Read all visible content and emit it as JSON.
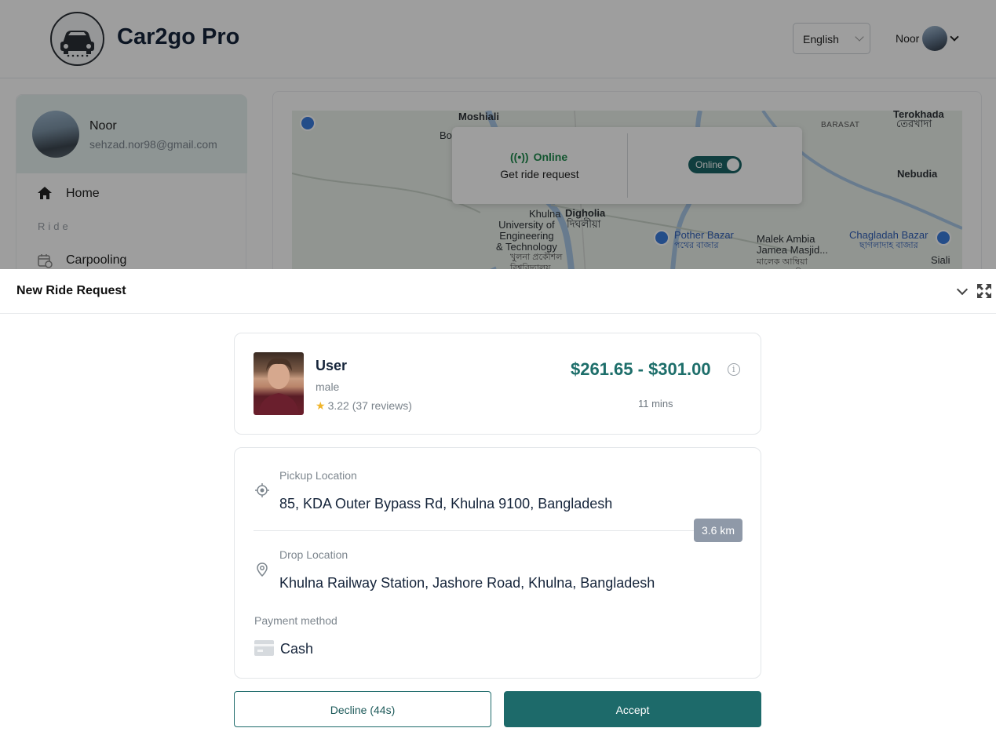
{
  "header": {
    "brand": "Car2go Pro",
    "language": "English",
    "user_name": "Noor"
  },
  "sidebar": {
    "profile_name": "Noor",
    "profile_email": "sehzad.nor98@gmail.com",
    "home_label": "Home",
    "section_label": "Ride",
    "carpooling_label": "Carpooling"
  },
  "map": {
    "labels": {
      "moshiali": "Moshiali",
      "bo": "Bo",
      "terokhada": "Terokhada",
      "terokhada_bn": "তেরখাদা",
      "barasat": "BARASAT",
      "nebudia": "Nebudia",
      "khulna": "Khulna",
      "digholia": "Digholia",
      "digholia_bn": "দিঘলীয়া",
      "university": "University of\nEngineering\n& Technology",
      "university_bn": "খুলনা প্রকৌশল\nবিশ্ববিদ্যালয়",
      "pother_bazar": "Pother Bazar",
      "pother_bazar_bn": "পথের বাজার",
      "malek_ambia": "Malek Ambia\nJamea Masjid...",
      "malek_ambia_bn": "মালেক আম্বিয়া\nজামেয়া মসজিদ",
      "chagladah": "Chagladah Bazar",
      "chagladah_bn": "ছাগলাদাহ বাজার",
      "siali": "Siali"
    }
  },
  "status_panel": {
    "status": "Online",
    "subtitle": "Get ride request",
    "toggle_label": "Online"
  },
  "sheet": {
    "title": "New Ride Request",
    "rider": {
      "name": "User",
      "gender": "male",
      "rating": "3.22 (37 reviews)"
    },
    "fare": "$261.65 - $301.00",
    "eta": "11 mins",
    "pickup_label": "Pickup Location",
    "pickup_value": "85, KDA Outer Bypass Rd, Khulna 9100, Bangladesh",
    "distance": "3.6 km",
    "drop_label": "Drop Location",
    "drop_value": "Khulna Railway Station, Jashore Road, Khulna, Bangladesh",
    "payment_label": "Payment method",
    "payment_value": "Cash",
    "decline_label": "Decline (44s)",
    "accept_label": "Accept"
  },
  "colors": {
    "accent": "#1d6a6a",
    "fare": "#1d6e6a",
    "online": "#1e8a4c"
  }
}
